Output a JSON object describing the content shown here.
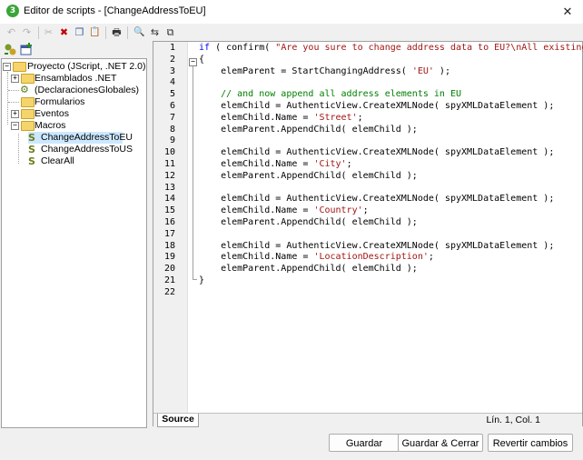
{
  "window": {
    "title": "Editor de scripts - [ChangeAddressToEU]",
    "app_icon": "altova-scripting-icon",
    "close_glyph": "✕"
  },
  "toolbar": {
    "undo_icon": "↶",
    "redo_icon": "↷",
    "cut_icon": "✂",
    "delete_icon": "✖",
    "copy_icon": "❐",
    "paste_icon": "📋",
    "print_icon": "🖶",
    "find_icon": "🔍",
    "replace_icon": "⇆",
    "find_next_icon": "⧉"
  },
  "tree": {
    "root": "Proyecto (JScript, .NET 2.0)",
    "items": [
      {
        "label": "Ensamblados .NET"
      },
      {
        "label": "(DeclaracionesGlobales)"
      },
      {
        "label": "Formularios"
      },
      {
        "label": "Eventos"
      },
      {
        "label": "Macros"
      }
    ],
    "macros": [
      {
        "label": "ChangeAddressToEU"
      },
      {
        "label": "ChangeAddressToUS"
      },
      {
        "label": "ClearAll"
      }
    ]
  },
  "editor": {
    "line_numbers": [
      "1",
      "2",
      "3",
      "4",
      "5",
      "6",
      "7",
      "8",
      "9",
      "10",
      "11",
      "12",
      "13",
      "14",
      "15",
      "16",
      "17",
      "18",
      "19",
      "20",
      "21",
      "22"
    ],
    "lines": [
      [
        {
          "t": "kw",
          "v": "if"
        },
        {
          "t": "p",
          "v": " ( confirm( "
        },
        {
          "t": "str",
          "v": "\"Are you sure to change address data to EU?\\nAll existing ad"
        }
      ],
      [
        {
          "t": "p",
          "v": "{"
        }
      ],
      [
        {
          "t": "p",
          "v": "    elemParent = StartChangingAddress( "
        },
        {
          "t": "str",
          "v": "'EU'"
        },
        {
          "t": "p",
          "v": " );"
        }
      ],
      [],
      [
        {
          "t": "cm",
          "v": "    // and now append all address elements in EU"
        }
      ],
      [
        {
          "t": "p",
          "v": "    elemChild = AuthenticView.CreateXMLNode( spyXMLDataElement );"
        }
      ],
      [
        {
          "t": "p",
          "v": "    elemChild.Name = "
        },
        {
          "t": "str",
          "v": "'Street'"
        },
        {
          "t": "p",
          "v": ";"
        }
      ],
      [
        {
          "t": "p",
          "v": "    elemParent.AppendChild( elemChild );"
        }
      ],
      [],
      [
        {
          "t": "p",
          "v": "    elemChild = AuthenticView.CreateXMLNode( spyXMLDataElement );"
        }
      ],
      [
        {
          "t": "p",
          "v": "    elemChild.Name = "
        },
        {
          "t": "str",
          "v": "'City'"
        },
        {
          "t": "p",
          "v": ";"
        }
      ],
      [
        {
          "t": "p",
          "v": "    elemParent.AppendChild( elemChild );"
        }
      ],
      [],
      [
        {
          "t": "p",
          "v": "    elemChild = AuthenticView.CreateXMLNode( spyXMLDataElement );"
        }
      ],
      [
        {
          "t": "p",
          "v": "    elemChild.Name = "
        },
        {
          "t": "str",
          "v": "'Country'"
        },
        {
          "t": "p",
          "v": ";"
        }
      ],
      [
        {
          "t": "p",
          "v": "    elemParent.AppendChild( elemChild );"
        }
      ],
      [],
      [
        {
          "t": "p",
          "v": "    elemChild = AuthenticView.CreateXMLNode( spyXMLDataElement );"
        }
      ],
      [
        {
          "t": "p",
          "v": "    elemChild.Name = "
        },
        {
          "t": "str",
          "v": "'LocationDescription'"
        },
        {
          "t": "p",
          "v": ";"
        }
      ],
      [
        {
          "t": "p",
          "v": "    elemParent.AppendChild( elemChild );"
        }
      ],
      [
        {
          "t": "p",
          "v": "}"
        }
      ],
      []
    ],
    "source_tab": "Source",
    "cursor_position": "Lín. 1, Col. 1"
  },
  "buttons": {
    "save": "Guardar",
    "save_close": "Guardar & Cerrar",
    "revert": "Revertir cambios"
  }
}
